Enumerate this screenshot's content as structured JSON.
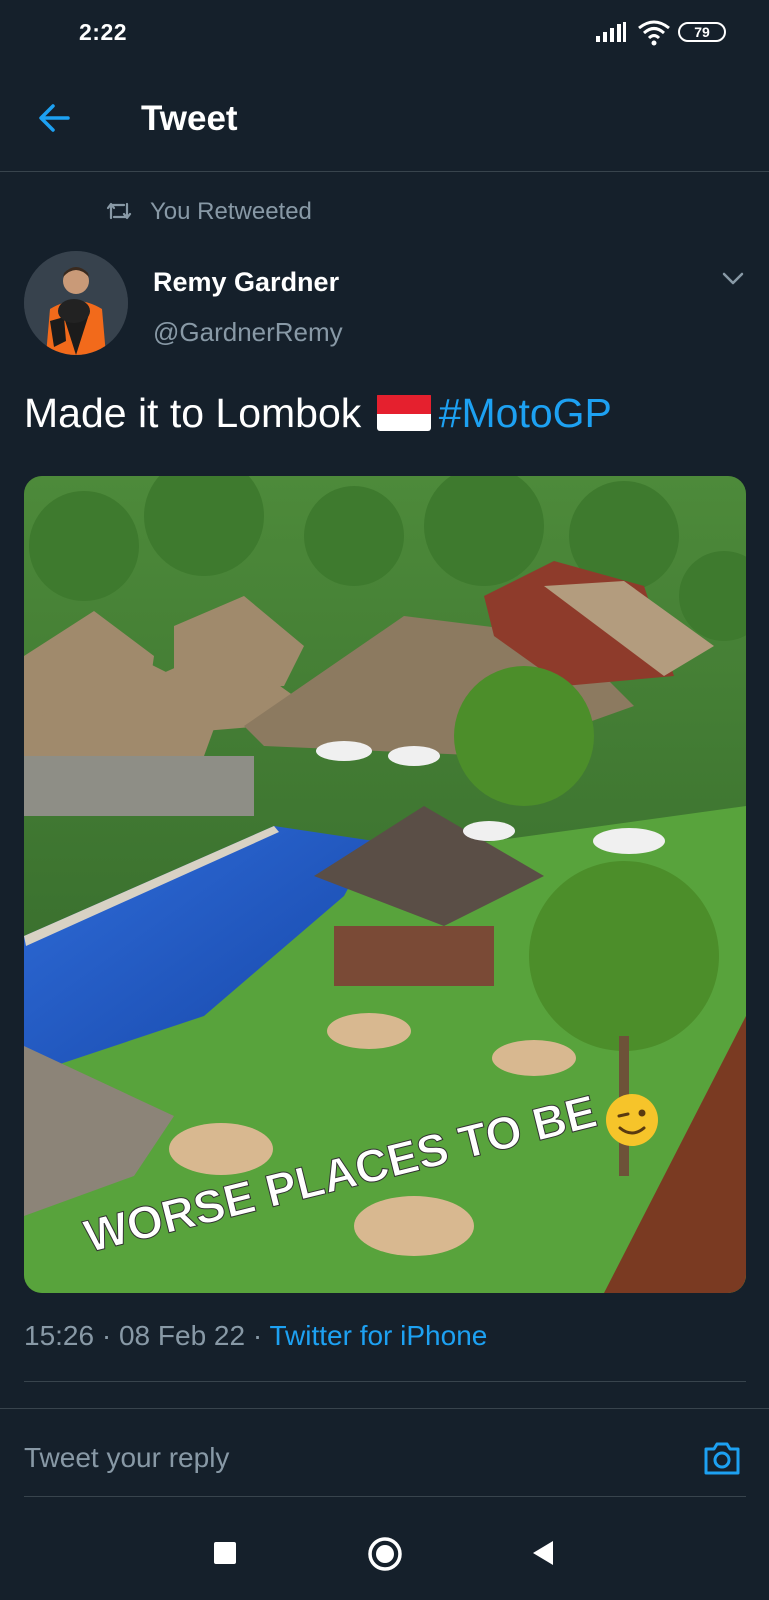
{
  "status_bar": {
    "time": "2:22",
    "battery": "79",
    "icons": [
      "signal-icon",
      "wifi-icon",
      "battery-icon"
    ]
  },
  "header": {
    "title": "Tweet",
    "back_icon": "arrow-left-icon"
  },
  "retweet": {
    "label": "You Retweeted",
    "icon": "retweet-icon"
  },
  "author": {
    "name": "Remy Gardner",
    "handle": "@GardnerRemy",
    "menu_icon": "chevron-down-icon"
  },
  "tweet": {
    "text": "Made it to Lombok",
    "flag": "indonesia-flag",
    "hashtag": "#MotoGP",
    "image_caption": "WORSE PLACES TO BE",
    "image_emoji": "winking-face"
  },
  "meta": {
    "time": "15:26",
    "date": "08 Feb 22",
    "client": "Twitter for iPhone"
  },
  "reply": {
    "placeholder": "Tweet your reply",
    "camera_icon": "camera-icon"
  },
  "nav_bar": {
    "icons": [
      "recent-apps-icon",
      "home-icon",
      "back-icon"
    ]
  },
  "colors": {
    "background": "#15202b",
    "accent": "#1da1f2",
    "secondary_text": "#8899a6",
    "divider": "#38444d"
  }
}
